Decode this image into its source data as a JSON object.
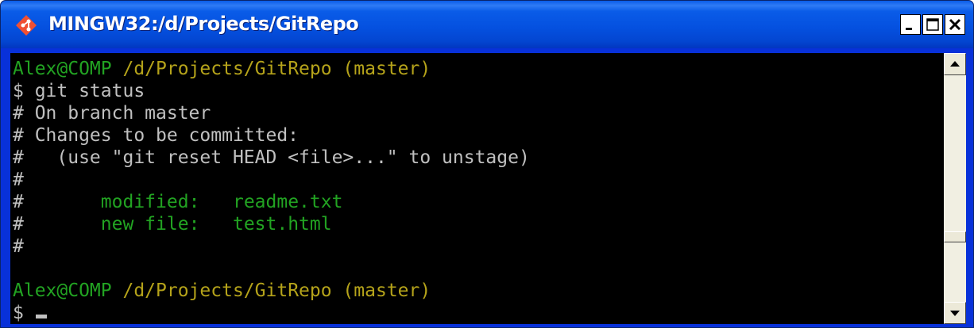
{
  "window": {
    "title": "MINGW32:/d/Projects/GitRepo",
    "icons": {
      "app": "git-diamond-icon",
      "minimize": "minimize-icon",
      "maximize": "maximize-icon",
      "close": "close-icon"
    },
    "colors": {
      "titlebar": "#0554e0",
      "console_bg": "#000000",
      "text": "#c0c0c0",
      "user_host": "#22a322",
      "path": "#b5a31a"
    }
  },
  "terminal": {
    "prompt1": {
      "user_host": "Alex@COMP",
      "space": " ",
      "path": "/d/Projects/GitRepo (master)"
    },
    "command": "$ git status",
    "branch_line": "# On branch master",
    "changes_line": "# Changes to be committed:",
    "hint_line": "#   (use \"git reset HEAD <file>...\" to unstage)",
    "empty_hash_1": "#",
    "modified": {
      "hash": "#",
      "indent": "       ",
      "label": "modified:",
      "gap": "   ",
      "file": "readme.txt"
    },
    "new_file": {
      "hash": "#",
      "indent": "       ",
      "label": "new file:",
      "gap": "   ",
      "file": "test.html"
    },
    "empty_hash_2": "#",
    "prompt2": {
      "user_host": "Alex@COMP",
      "space": " ",
      "path": "/d/Projects/GitRepo (master)"
    },
    "final_prompt": "$"
  }
}
